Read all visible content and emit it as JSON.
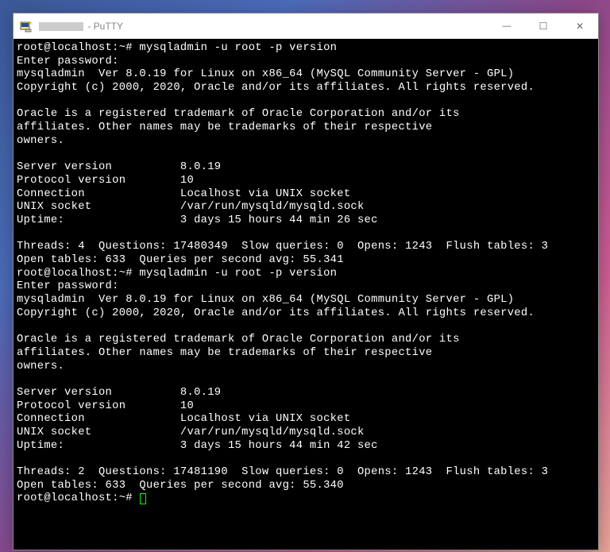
{
  "window": {
    "title_suffix": " - PuTTY",
    "controls": {
      "minimize_glyph": "—",
      "maximize_glyph": "☐",
      "close_glyph": "✕"
    }
  },
  "terminal": {
    "run1": {
      "prompt_cmd": "root@localhost:~# mysqladmin -u root -p version",
      "enter_pw": "Enter password:",
      "ver_line": "mysqladmin  Ver 8.0.19 for Linux on x86_64 (MySQL Community Server - GPL)",
      "copyright": "Copyright (c) 2000, 2020, Oracle and/or its affiliates. All rights reserved.",
      "trademark1": "Oracle is a registered trademark of Oracle Corporation and/or its",
      "trademark2": "affiliates. Other names may be trademarks of their respective",
      "trademark3": "owners.",
      "kv_server_version": "Server version          8.0.19",
      "kv_protocol": "Protocol version        10",
      "kv_connection": "Connection              Localhost via UNIX socket",
      "kv_unix_socket": "UNIX socket             /var/run/mysqld/mysqld.sock",
      "kv_uptime": "Uptime:                 3 days 15 hours 44 min 26 sec",
      "stats1": "Threads: 4  Questions: 17480349  Slow queries: 0  Opens: 1243  Flush tables: 3",
      "stats2": "Open tables: 633  Queries per second avg: 55.341"
    },
    "run2": {
      "prompt_cmd": "root@localhost:~# mysqladmin -u root -p version",
      "enter_pw": "Enter password:",
      "ver_line": "mysqladmin  Ver 8.0.19 for Linux on x86_64 (MySQL Community Server - GPL)",
      "copyright": "Copyright (c) 2000, 2020, Oracle and/or its affiliates. All rights reserved.",
      "trademark1": "Oracle is a registered trademark of Oracle Corporation and/or its",
      "trademark2": "affiliates. Other names may be trademarks of their respective",
      "trademark3": "owners.",
      "kv_server_version": "Server version          8.0.19",
      "kv_protocol": "Protocol version        10",
      "kv_connection": "Connection              Localhost via UNIX socket",
      "kv_unix_socket": "UNIX socket             /var/run/mysqld/mysqld.sock",
      "kv_uptime": "Uptime:                 3 days 15 hours 44 min 42 sec",
      "stats1": "Threads: 2  Questions: 17481190  Slow queries: 0  Opens: 1243  Flush tables: 3",
      "stats2": "Open tables: 633  Queries per second avg: 55.340"
    },
    "final_prompt": "root@localhost:~# "
  }
}
